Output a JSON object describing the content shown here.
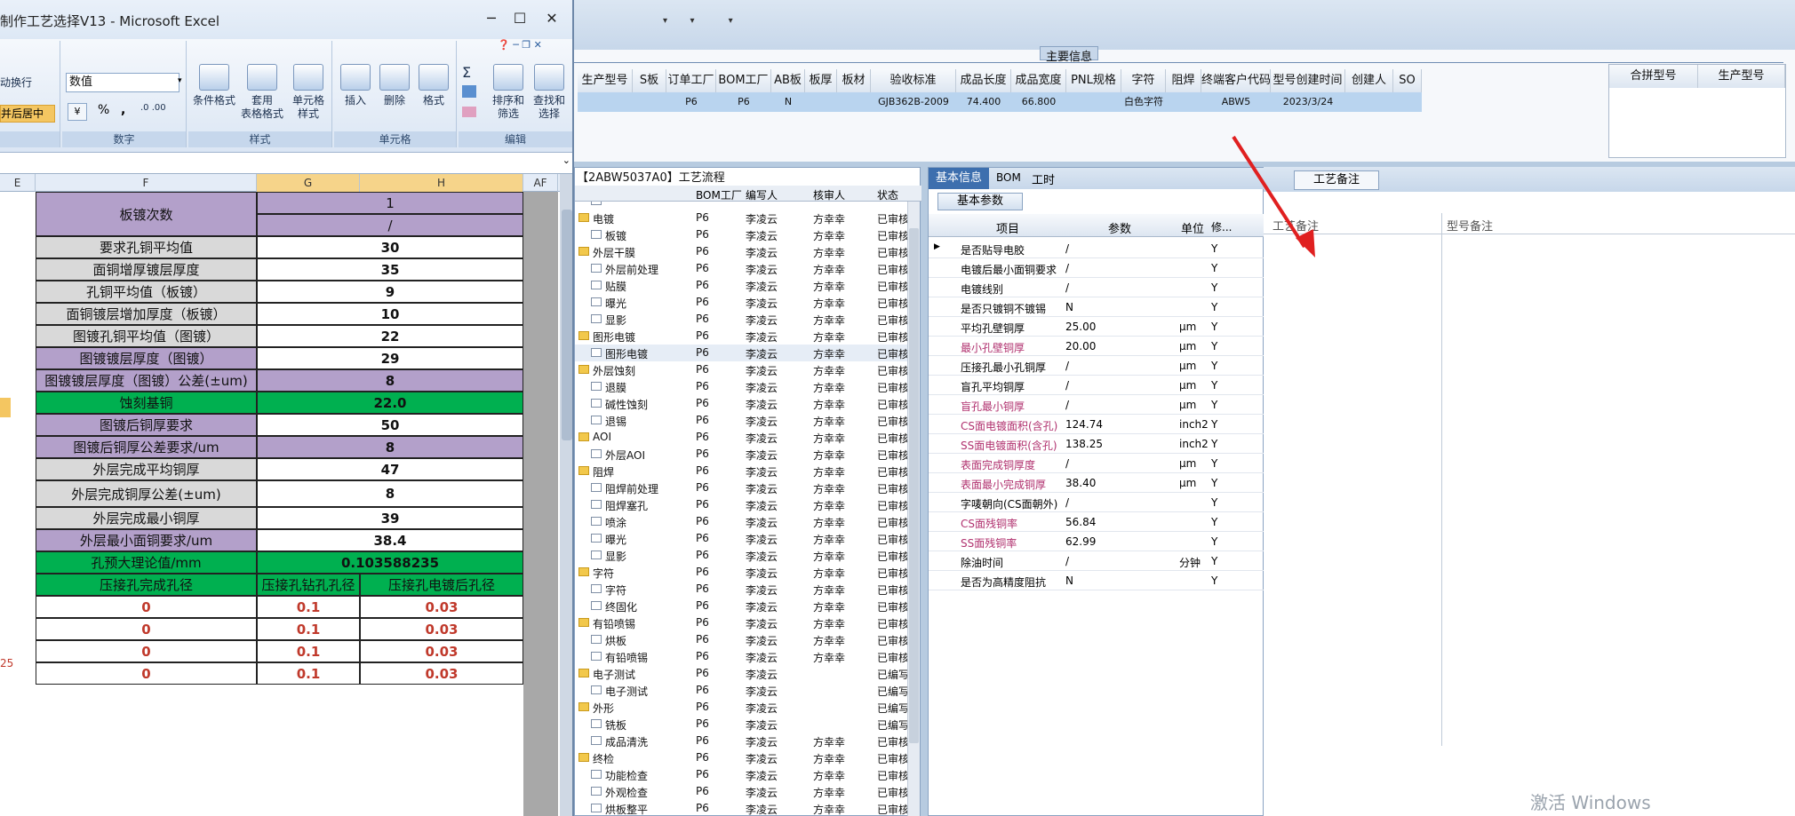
{
  "excel": {
    "title": "制作工艺选择V13 - Microsoft Excel",
    "ribbon": {
      "wrap_text": "动换行",
      "merge_center": "并后居中",
      "number_format": "数值",
      "percent": "%",
      "comma": ",",
      "cond_format": "条件格式",
      "table_format_1": "套用",
      "table_format_2": "表格格式",
      "cell_style_1": "单元格",
      "cell_style_2": "样式",
      "insert": "插入",
      "delete": "删除",
      "format": "格式",
      "sort_1": "排序和",
      "sort_2": "筛选",
      "find_1": "查找和",
      "find_2": "选择",
      "sigma": "Σ",
      "groups": [
        "数字",
        "样式",
        "单元格",
        "编辑"
      ]
    },
    "columns": [
      "E",
      "F",
      "G",
      "H",
      "AF"
    ],
    "rows": [
      {
        "label": "板镀次数",
        "value": "1",
        "value2": "/",
        "color": "purple"
      },
      {
        "label": "要求孔铜平均值",
        "value": "30",
        "color": "gray"
      },
      {
        "label": "面铜增厚镀层厚度",
        "value": "35",
        "color": "gray"
      },
      {
        "label": "孔铜平均值（板镀）",
        "value": "9",
        "color": "gray"
      },
      {
        "label": "面铜镀层增加厚度（板镀）",
        "value": "10",
        "color": "gray"
      },
      {
        "label": "图镀孔铜平均值（图镀）",
        "value": "22",
        "color": "gray"
      },
      {
        "label": "图镀镀层厚度（图镀）",
        "value": "29",
        "color": "purple"
      },
      {
        "label": "图镀镀层厚度（图镀）公差(±um)",
        "value": "8",
        "color": "purple"
      },
      {
        "label": "蚀刻基铜",
        "value": "22.0",
        "color": "green"
      },
      {
        "label": "图镀后铜厚要求",
        "value": "50",
        "color": "purple"
      },
      {
        "label": "图镀后铜厚公差要求/um",
        "value": "8",
        "color": "purple"
      },
      {
        "label": "外层完成平均铜厚",
        "value": "47",
        "color": "gray"
      },
      {
        "label": "外层完成铜厚公差(±um)",
        "value": "8",
        "color": "gray"
      },
      {
        "label": "外层完成最小铜厚",
        "value": "39",
        "color": "gray"
      },
      {
        "label": "外层最小面铜要求/um",
        "value": "38.4",
        "color": "purple"
      },
      {
        "label": "孔预大理论值/mm",
        "value": "0.103588235",
        "color": "green"
      }
    ],
    "sub_headers": [
      "压接孔完成孔径",
      "压接孔钻孔孔径",
      "压接孔电镀后孔径"
    ],
    "data_rows": [
      [
        "0",
        "0.1",
        "0.03"
      ],
      [
        "0",
        "0.1",
        "0.03"
      ],
      [
        "0",
        "0.1",
        "0.03"
      ],
      [
        "0",
        "0.1",
        "0.03"
      ]
    ],
    "left_fragments": {
      "left_num": "25",
      "watermark": "1"
    }
  },
  "top": {
    "section_title": "主要信息",
    "columns": [
      "生产型号",
      "S板",
      "订单工厂",
      "BOM工厂",
      "AB板",
      "板厚",
      "板材",
      "验收标准",
      "成品长度",
      "成品宽度",
      "PNL规格",
      "字符",
      "阻焊",
      "终端客户代码",
      "型号创建时间",
      "创建人",
      "SO"
    ],
    "row": [
      "",
      "",
      "P6",
      "P6",
      "N",
      "",
      "",
      "GJB362B-2009",
      "74.400",
      "66.800",
      "",
      "白色字符",
      "",
      "ABW5",
      "2023/3/24",
      "",
      ""
    ],
    "right_cols": [
      "合拼型号",
      "生产型号"
    ]
  },
  "tree": {
    "title": "【2ABW5037A0】工艺流程",
    "headers": [
      "BOM工厂",
      "编写人",
      "核审人",
      "状态"
    ],
    "items": [
      {
        "name": "",
        "lvl": 1,
        "folder": false,
        "bom": "",
        "writer": "",
        "checker": "",
        "status": ""
      },
      {
        "name": "电镀",
        "lvl": 0,
        "folder": true,
        "bom": "P6",
        "writer": "李凌云",
        "checker": "方幸幸",
        "status": "已审核"
      },
      {
        "name": "板镀",
        "lvl": 1,
        "folder": false,
        "bom": "P6",
        "writer": "李凌云",
        "checker": "方幸幸",
        "status": "已审核"
      },
      {
        "name": "外层干膜",
        "lvl": 0,
        "folder": true,
        "bom": "P6",
        "writer": "李凌云",
        "checker": "方幸幸",
        "status": "已审核"
      },
      {
        "name": "外层前处理",
        "lvl": 1,
        "folder": false,
        "bom": "P6",
        "writer": "李凌云",
        "checker": "方幸幸",
        "status": "已审核"
      },
      {
        "name": "贴膜",
        "lvl": 1,
        "folder": false,
        "bom": "P6",
        "writer": "李凌云",
        "checker": "方幸幸",
        "status": "已审核"
      },
      {
        "name": "曝光",
        "lvl": 1,
        "folder": false,
        "bom": "P6",
        "writer": "李凌云",
        "checker": "方幸幸",
        "status": "已审核"
      },
      {
        "name": "显影",
        "lvl": 1,
        "folder": false,
        "bom": "P6",
        "writer": "李凌云",
        "checker": "方幸幸",
        "status": "已审核"
      },
      {
        "name": "图形电镀",
        "lvl": 0,
        "folder": true,
        "bom": "P6",
        "writer": "李凌云",
        "checker": "方幸幸",
        "status": "已审核"
      },
      {
        "name": "图形电镀",
        "lvl": 1,
        "folder": false,
        "bom": "P6",
        "writer": "李凌云",
        "checker": "方幸幸",
        "status": "已审核"
      },
      {
        "name": "外层蚀刻",
        "lvl": 0,
        "folder": true,
        "bom": "P6",
        "writer": "李凌云",
        "checker": "方幸幸",
        "status": "已审核"
      },
      {
        "name": "退膜",
        "lvl": 1,
        "folder": false,
        "bom": "P6",
        "writer": "李凌云",
        "checker": "方幸幸",
        "status": "已审核"
      },
      {
        "name": "碱性蚀刻",
        "lvl": 1,
        "folder": false,
        "bom": "P6",
        "writer": "李凌云",
        "checker": "方幸幸",
        "status": "已审核"
      },
      {
        "name": "退锡",
        "lvl": 1,
        "folder": false,
        "bom": "P6",
        "writer": "李凌云",
        "checker": "方幸幸",
        "status": "已审核"
      },
      {
        "name": "AOI",
        "lvl": 0,
        "folder": true,
        "bom": "P6",
        "writer": "李凌云",
        "checker": "方幸幸",
        "status": "已审核"
      },
      {
        "name": "外层AOI",
        "lvl": 1,
        "folder": false,
        "bom": "P6",
        "writer": "李凌云",
        "checker": "方幸幸",
        "status": "已审核"
      },
      {
        "name": "阻焊",
        "lvl": 0,
        "folder": true,
        "bom": "P6",
        "writer": "李凌云",
        "checker": "方幸幸",
        "status": "已审核"
      },
      {
        "name": "阻焊前处理",
        "lvl": 1,
        "folder": false,
        "bom": "P6",
        "writer": "李凌云",
        "checker": "方幸幸",
        "status": "已审核"
      },
      {
        "name": "阻焊塞孔",
        "lvl": 1,
        "folder": false,
        "bom": "P6",
        "writer": "李凌云",
        "checker": "方幸幸",
        "status": "已审核"
      },
      {
        "name": "喷涂",
        "lvl": 1,
        "folder": false,
        "bom": "P6",
        "writer": "李凌云",
        "checker": "方幸幸",
        "status": "已审核"
      },
      {
        "name": "曝光",
        "lvl": 1,
        "folder": false,
        "bom": "P6",
        "writer": "李凌云",
        "checker": "方幸幸",
        "status": "已审核"
      },
      {
        "name": "显影",
        "lvl": 1,
        "folder": false,
        "bom": "P6",
        "writer": "李凌云",
        "checker": "方幸幸",
        "status": "已审核"
      },
      {
        "name": "字符",
        "lvl": 0,
        "folder": true,
        "bom": "P6",
        "writer": "李凌云",
        "checker": "方幸幸",
        "status": "已审核"
      },
      {
        "name": "字符",
        "lvl": 1,
        "folder": false,
        "bom": "P6",
        "writer": "李凌云",
        "checker": "方幸幸",
        "status": "已审核"
      },
      {
        "name": "终固化",
        "lvl": 1,
        "folder": false,
        "bom": "P6",
        "writer": "李凌云",
        "checker": "方幸幸",
        "status": "已审核"
      },
      {
        "name": "有铅喷锡",
        "lvl": 0,
        "folder": true,
        "bom": "P6",
        "writer": "李凌云",
        "checker": "方幸幸",
        "status": "已审核"
      },
      {
        "name": "烘板",
        "lvl": 1,
        "folder": false,
        "bom": "P6",
        "writer": "李凌云",
        "checker": "方幸幸",
        "status": "已审核"
      },
      {
        "name": "有铅喷锡",
        "lvl": 1,
        "folder": false,
        "bom": "P6",
        "writer": "李凌云",
        "checker": "方幸幸",
        "status": "已审核"
      },
      {
        "name": "电子测试",
        "lvl": 0,
        "folder": true,
        "bom": "P6",
        "writer": "李凌云",
        "checker": "",
        "status": "已编写"
      },
      {
        "name": "电子测试",
        "lvl": 1,
        "folder": false,
        "bom": "P6",
        "writer": "李凌云",
        "checker": "",
        "status": "已编写"
      },
      {
        "name": "外形",
        "lvl": 0,
        "folder": true,
        "bom": "P6",
        "writer": "李凌云",
        "checker": "",
        "status": "已编写"
      },
      {
        "name": "铣板",
        "lvl": 1,
        "folder": false,
        "bom": "P6",
        "writer": "李凌云",
        "checker": "",
        "status": "已编写"
      },
      {
        "name": "成品清洗",
        "lvl": 1,
        "folder": false,
        "bom": "P6",
        "writer": "李凌云",
        "checker": "方幸幸",
        "status": "已审核"
      },
      {
        "name": "终检",
        "lvl": 0,
        "folder": true,
        "bom": "P6",
        "writer": "李凌云",
        "checker": "方幸幸",
        "status": "已审核"
      },
      {
        "name": "功能检查",
        "lvl": 1,
        "folder": false,
        "bom": "P6",
        "writer": "李凌云",
        "checker": "方幸幸",
        "status": "已审核"
      },
      {
        "name": "外观检查",
        "lvl": 1,
        "folder": false,
        "bom": "P6",
        "writer": "李凌云",
        "checker": "方幸幸",
        "status": "已审核"
      },
      {
        "name": "烘板整平",
        "lvl": 1,
        "folder": false,
        "bom": "P6",
        "writer": "李凌云",
        "checker": "方幸幸",
        "status": "已审核"
      }
    ]
  },
  "params": {
    "tabs": [
      "基本信息",
      "BOM",
      "工时"
    ],
    "subtab": "基本参数",
    "headers": [
      "项目",
      "参数",
      "单位",
      "修..."
    ],
    "rows": [
      {
        "item": "是否贴导电胶",
        "param": "/",
        "unit": "",
        "flag": "Y",
        "pink": false
      },
      {
        "item": "电镀后最小面铜要求",
        "param": "/",
        "unit": "",
        "flag": "Y",
        "pink": false
      },
      {
        "item": "电镀线别",
        "param": "/",
        "unit": "",
        "flag": "Y",
        "pink": false
      },
      {
        "item": "是否只镀铜不镀锡",
        "param": "N",
        "unit": "",
        "flag": "Y",
        "pink": false
      },
      {
        "item": "平均孔壁铜厚",
        "param": "25.00",
        "unit": "μm",
        "flag": "Y",
        "pink": false
      },
      {
        "item": "最小孔壁铜厚",
        "param": "20.00",
        "unit": "μm",
        "flag": "Y",
        "pink": true
      },
      {
        "item": "压接孔最小孔铜厚",
        "param": "/",
        "unit": "μm",
        "flag": "Y",
        "pink": false
      },
      {
        "item": "盲孔平均铜厚",
        "param": "/",
        "unit": "μm",
        "flag": "Y",
        "pink": false
      },
      {
        "item": "盲孔最小铜厚",
        "param": "/",
        "unit": "μm",
        "flag": "Y",
        "pink": true
      },
      {
        "item": "CS面电镀面积(含孔)",
        "param": "124.74",
        "unit": "inch2",
        "flag": "Y",
        "pink": true
      },
      {
        "item": "SS面电镀面积(含孔)",
        "param": "138.25",
        "unit": "inch2",
        "flag": "Y",
        "pink": true
      },
      {
        "item": "表面完成铜厚度",
        "param": "/",
        "unit": "μm",
        "flag": "Y",
        "pink": true
      },
      {
        "item": "表面最小完成铜厚",
        "param": "38.40",
        "unit": "μm",
        "flag": "Y",
        "pink": true
      },
      {
        "item": "字唛朝向(CS面朝外)",
        "param": "/",
        "unit": "",
        "flag": "Y",
        "pink": false
      },
      {
        "item": "CS面残铜率",
        "param": "56.84",
        "unit": "",
        "flag": "Y",
        "pink": true
      },
      {
        "item": "SS面残铜率",
        "param": "62.99",
        "unit": "",
        "flag": "Y",
        "pink": true
      },
      {
        "item": "除油时间",
        "param": "/",
        "unit": "分钟",
        "flag": "Y",
        "pink": false
      },
      {
        "item": "是否为高精度阻抗",
        "param": "N",
        "unit": "",
        "flag": "Y",
        "pink": false
      }
    ]
  },
  "remarks": {
    "tab": "工艺备注",
    "col1": "工艺备注",
    "col2": "型号备注"
  },
  "watermark": "激活 Windows"
}
